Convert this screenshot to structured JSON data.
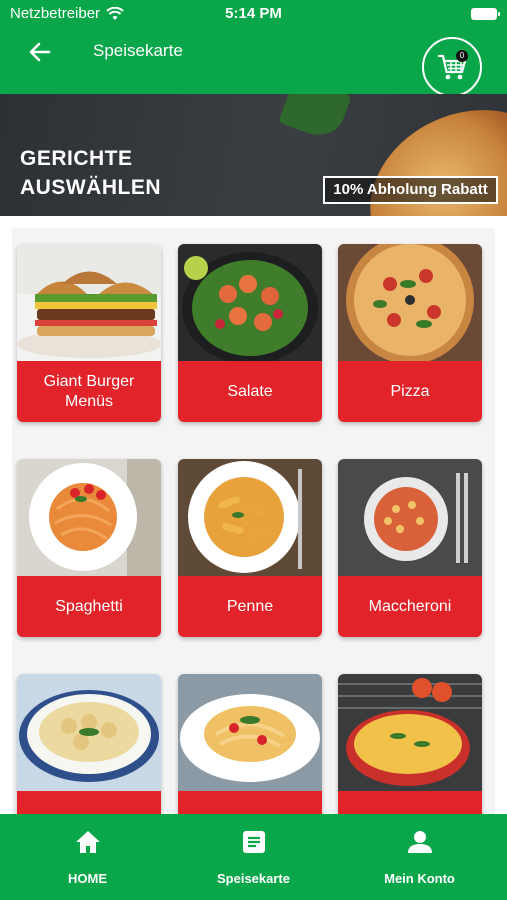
{
  "status_bar": {
    "carrier": "Netzbetreiber",
    "time": "5:14 PM"
  },
  "navbar": {
    "title": "Speisekarte",
    "cart_count": "0"
  },
  "banner": {
    "title_line1": "GERICHTE",
    "title_line2": "AUSWÄHLEN",
    "badge": "10% Abholung Rabatt"
  },
  "categories": [
    {
      "label": "Giant Burger Menüs"
    },
    {
      "label": "Salate"
    },
    {
      "label": "Pizza"
    },
    {
      "label": "Spaghetti"
    },
    {
      "label": "Penne"
    },
    {
      "label": "Maccheroni"
    }
  ],
  "tabbar": {
    "home": "HOME",
    "menu": "Speisekarte",
    "account": "Mein Konto"
  },
  "colors": {
    "brand_green": "#0aa64a",
    "accent_red": "#e3232a"
  }
}
